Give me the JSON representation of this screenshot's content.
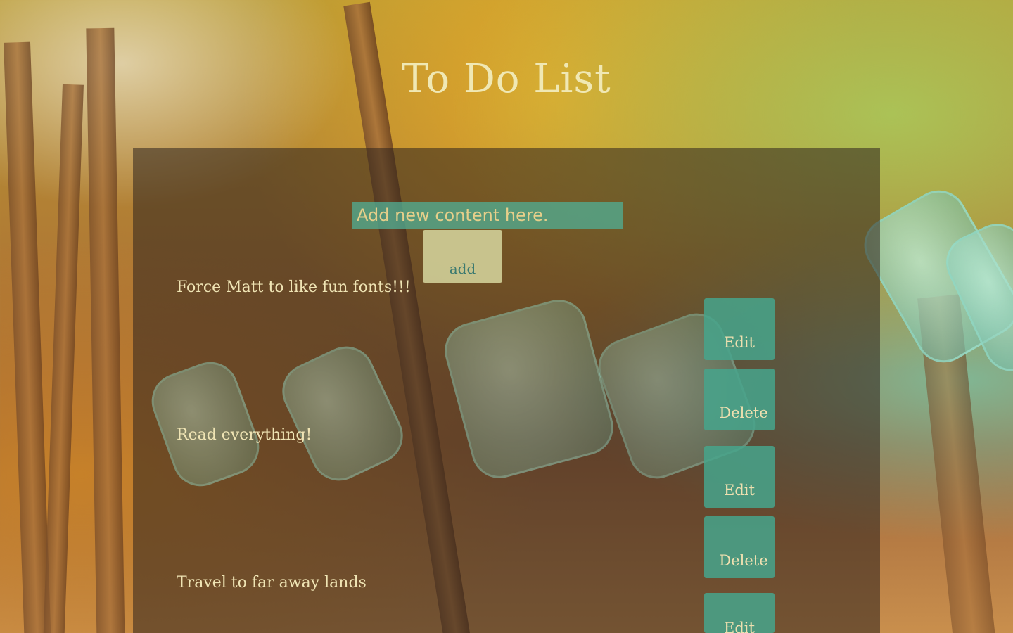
{
  "header": {
    "title": "To Do List"
  },
  "form": {
    "input_placeholder": "Add new content here.",
    "add_label": "add"
  },
  "tasks": [
    {
      "text": "Force Matt to like fun fonts!!!",
      "edit_label": "Edit",
      "delete_label": "Delete"
    },
    {
      "text": "Read everything!",
      "edit_label": "Edit",
      "delete_label": "Delete"
    },
    {
      "text": "Travel to far away lands",
      "edit_label": "Edit"
    }
  ]
}
